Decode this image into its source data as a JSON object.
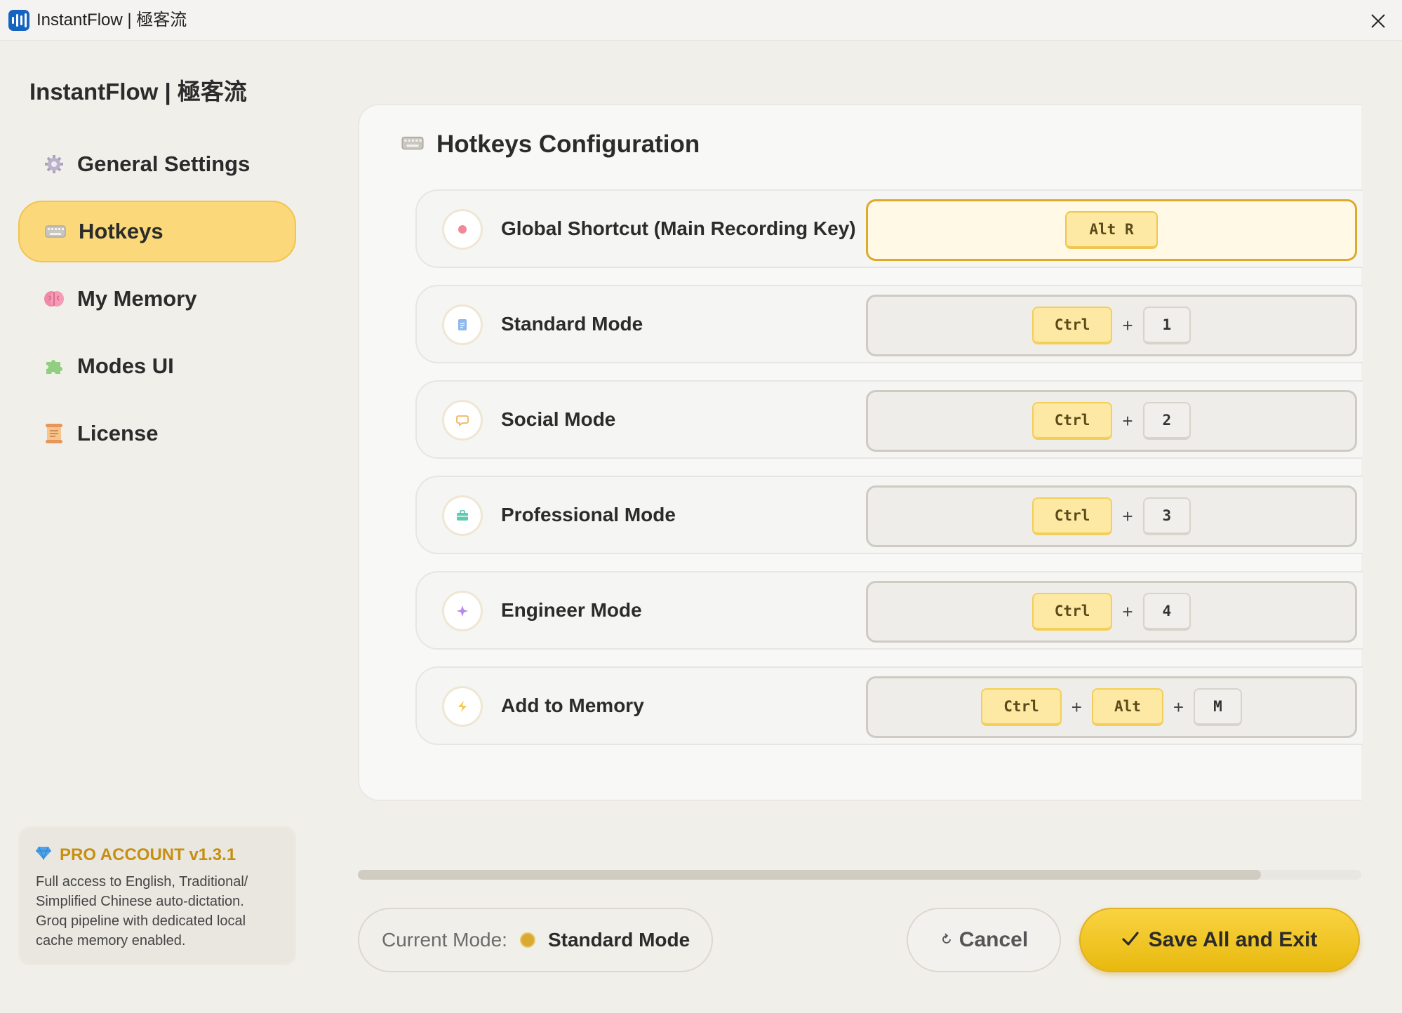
{
  "window": {
    "title": "InstantFlow | 極客流",
    "close_icon": "close-icon"
  },
  "sidebar": {
    "brand": "InstantFlow | 極客流",
    "items": [
      {
        "label": "General Settings",
        "icon": "gear-icon",
        "active": false
      },
      {
        "label": "Hotkeys",
        "icon": "keyboard-icon",
        "active": true
      },
      {
        "label": "My Memory",
        "icon": "brain-icon",
        "active": false
      },
      {
        "label": "Modes  UI",
        "icon": "puzzle-icon",
        "active": false
      },
      {
        "label": "License",
        "icon": "scroll-icon",
        "active": false
      }
    ],
    "pro_card": {
      "title": "PRO ACCOUNT v1.3.1",
      "icon": "gem-icon",
      "description": "Full access to English, Traditional/ Simplified Chinese auto-dictation. Groq pipeline with dedicated local cache memory enabled."
    }
  },
  "main": {
    "title": "Hotkeys Configuration",
    "icon": "keyboard-icon",
    "rows": [
      {
        "label": "Global Shortcut (Main Recording Key)",
        "icon": "record-icon",
        "keys": [
          "Alt R"
        ],
        "active": true
      },
      {
        "label": "Standard Mode",
        "icon": "document-icon",
        "keys": [
          "Ctrl",
          "1"
        ],
        "active": false
      },
      {
        "label": "Social Mode",
        "icon": "chat-icon",
        "keys": [
          "Ctrl",
          "2"
        ],
        "active": false
      },
      {
        "label": "Professional Mode",
        "icon": "briefcase-icon",
        "keys": [
          "Ctrl",
          "3"
        ],
        "active": false
      },
      {
        "label": "Engineer Mode",
        "icon": "sparkle-icon",
        "keys": [
          "Ctrl",
          "4"
        ],
        "active": false
      },
      {
        "label": "Add to Memory",
        "icon": "lightning-icon",
        "keys": [
          "Ctrl",
          "Alt",
          "M"
        ],
        "active": false
      }
    ],
    "plus_symbol": "+"
  },
  "scroll": {
    "progress": 0.9
  },
  "footer": {
    "current_mode_label": "Current Mode:",
    "current_mode_value": "Standard Mode",
    "cancel_label": "Cancel",
    "cancel_icon": "undo-icon",
    "save_label": "Save All and Exit",
    "save_icon": "check-icon"
  },
  "colors": {
    "accent": "#fbd97a",
    "save_button": "#f2c528",
    "pro_title": "#c78f10",
    "mode_dot": "#d9a930"
  }
}
